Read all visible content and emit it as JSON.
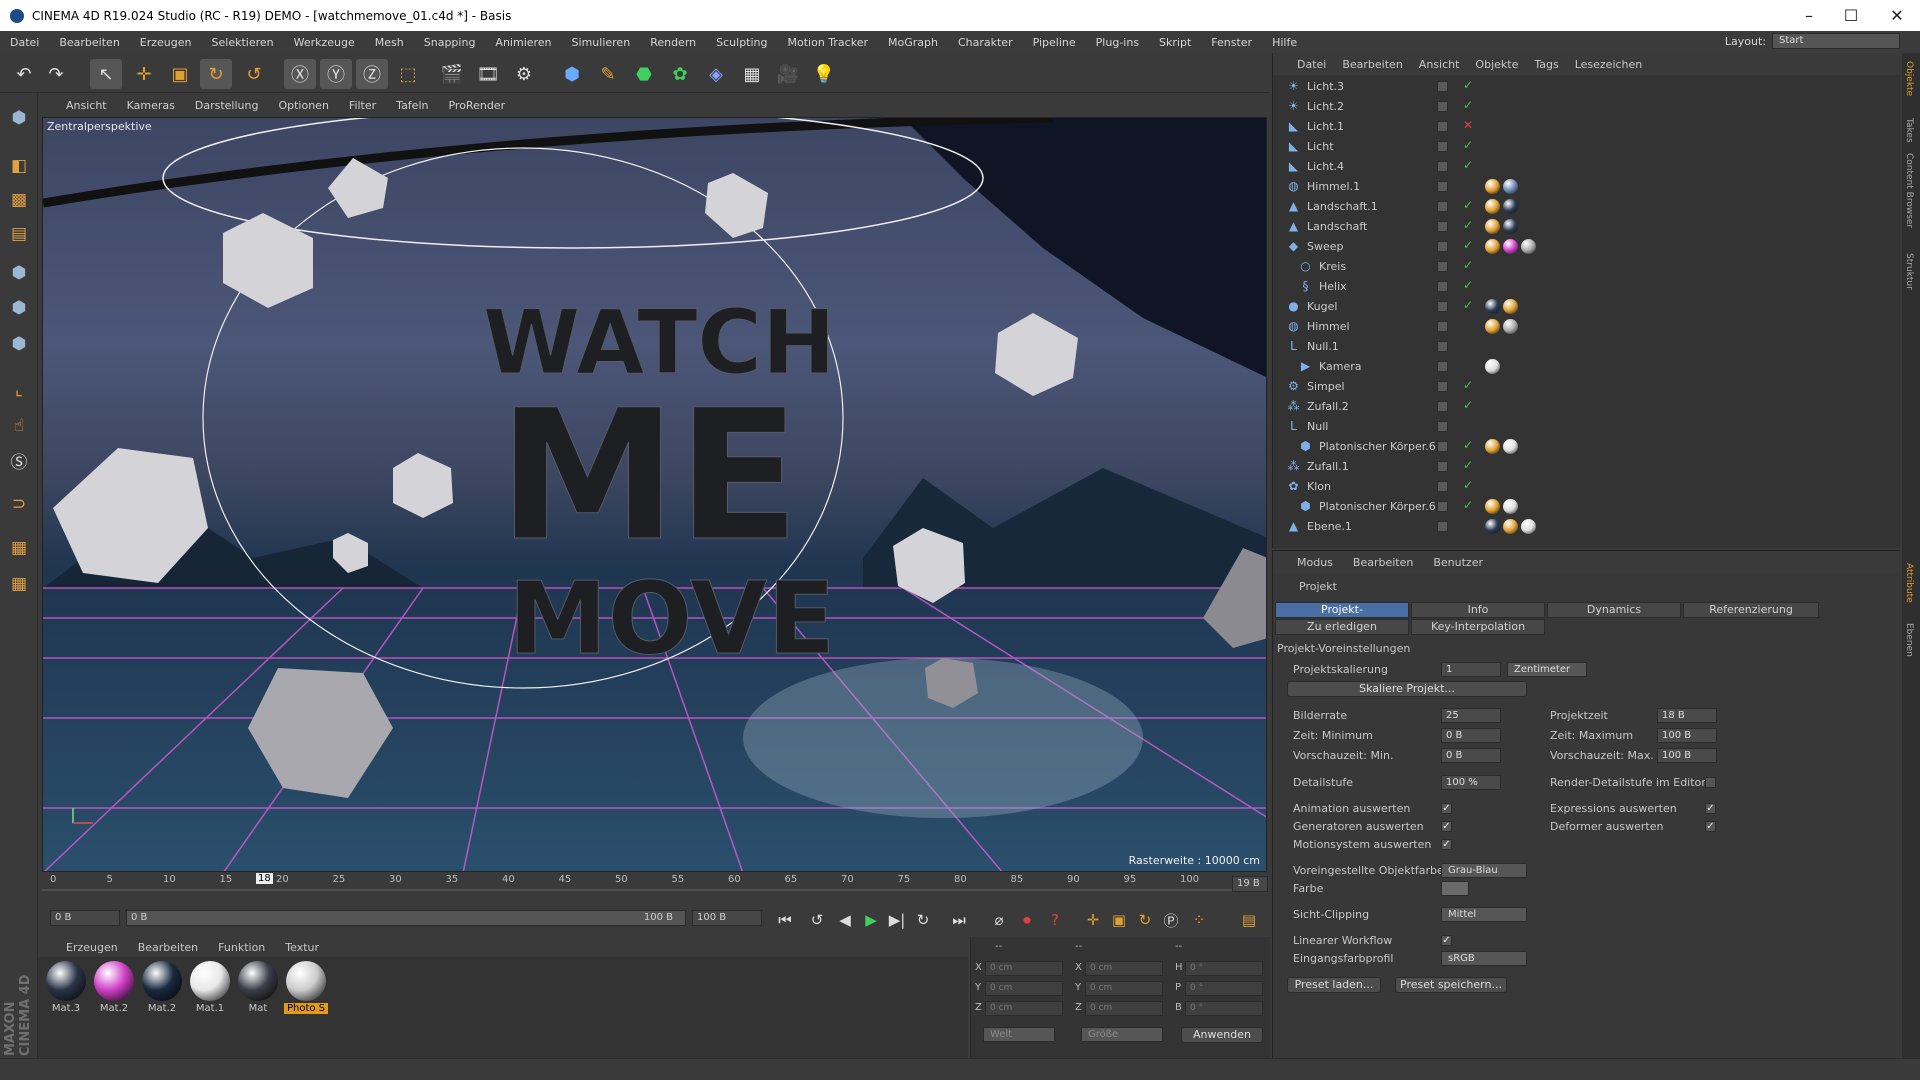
{
  "window": {
    "title": "CINEMA 4D R19.024 Studio (RC - R19) DEMO - [watchmemove_01.c4d *] - Basis",
    "minimize": "–",
    "maximize": "☐",
    "close": "✕"
  },
  "menubar": {
    "items": [
      "Datei",
      "Bearbeiten",
      "Erzeugen",
      "Selektieren",
      "Werkzeuge",
      "Mesh",
      "Snapping",
      "Animieren",
      "Simulieren",
      "Rendern",
      "Sculpting",
      "Motion Tracker",
      "MoGraph",
      "Charakter",
      "Pipeline",
      "Plug-ins",
      "Skript",
      "Fenster",
      "Hilfe"
    ],
    "layout_label": "Layout:",
    "layout_value": "Start"
  },
  "toolbar": {
    "tools": [
      "undo-icon",
      "select-icon",
      "move-icon",
      "scale-icon",
      "rotate-icon",
      "rotate-icon",
      "x-axis-icon",
      "y-axis-icon",
      "z-axis-icon",
      "coord-icon",
      "render-view-icon",
      "render-icon",
      "render-settings-icon",
      "cube-icon",
      "pen-icon",
      "subdivision-icon",
      "cloner-icon",
      "deformer-icon",
      "floor-icon",
      "camera-icon",
      "light-icon"
    ]
  },
  "viewport": {
    "menu": [
      "Ansicht",
      "Kameras",
      "Darstellung",
      "Optionen",
      "Filter",
      "Tafeln",
      "ProRender"
    ],
    "camera_label": "Zentralperspektive",
    "raster_label": "Rasterweite : 10000 cm",
    "text_lines": [
      "WATCH",
      "ME",
      "MOVE"
    ]
  },
  "timeline": {
    "ticks": [
      "0",
      "5",
      "10",
      "15",
      "20",
      "25",
      "30",
      "35",
      "40",
      "45",
      "50",
      "55",
      "60",
      "65",
      "70",
      "75",
      "80",
      "85",
      "90",
      "95",
      "100"
    ],
    "current_frame": "18",
    "end_label": "19 B",
    "start_field": "0 B",
    "range_start": "0 B",
    "range_end": "100 B",
    "end_field": "100 B"
  },
  "materials": {
    "menu": [
      "Erzeugen",
      "Bearbeiten",
      "Funktion",
      "Textur"
    ],
    "items": [
      {
        "name": "Mat.3",
        "color": "#2a3448"
      },
      {
        "name": "Mat.2",
        "color": "#d040c8"
      },
      {
        "name": "Mat.2",
        "color": "#1a2a40"
      },
      {
        "name": "Mat.1",
        "color": "#e8e8e8"
      },
      {
        "name": "Mat",
        "color": "#3a3e48"
      },
      {
        "name": "Photo S",
        "color": "#cccccc"
      }
    ]
  },
  "coords": {
    "header": [
      "--",
      "--",
      "--"
    ],
    "rows": [
      {
        "a": "X",
        "av": "0 cm",
        "b": "X",
        "bv": "0 cm",
        "c": "H",
        "cv": "0 °"
      },
      {
        "a": "Y",
        "av": "0 cm",
        "b": "Y",
        "bv": "0 cm",
        "c": "P",
        "cv": "0 °"
      },
      {
        "a": "Z",
        "av": "0 cm",
        "b": "Z",
        "bv": "0 cm",
        "c": "B",
        "cv": "0 °"
      }
    ],
    "mode1": "Welt",
    "mode2": "Größe",
    "apply": "Anwenden"
  },
  "objects": {
    "menu": [
      "Datei",
      "Bearbeiten",
      "Ansicht",
      "Objekte",
      "Tags",
      "Lesezeichen"
    ],
    "rows": [
      {
        "name": "Licht.3",
        "indent": 0,
        "icon": "light-icon",
        "mark": "✓",
        "markColor": "#46c846"
      },
      {
        "name": "Licht.2",
        "indent": 0,
        "icon": "light-icon",
        "mark": "✓",
        "markColor": "#46c846"
      },
      {
        "name": "Licht.1",
        "indent": 0,
        "icon": "spotlight-icon",
        "mark": "✕",
        "markColor": "#e04040"
      },
      {
        "name": "Licht",
        "indent": 0,
        "icon": "spotlight-icon",
        "mark": "✓",
        "markColor": "#46c846"
      },
      {
        "name": "Licht.4",
        "indent": 0,
        "icon": "spotlight-icon",
        "mark": "✓",
        "markColor": "#46c846"
      },
      {
        "name": "Himmel.1",
        "indent": 0,
        "icon": "sky-icon",
        "mark": "",
        "markColor": "#46c846"
      },
      {
        "name": "Landschaft.1",
        "indent": 0,
        "icon": "landscape-icon",
        "mark": "✓",
        "markColor": "#46c846"
      },
      {
        "name": "Landschaft",
        "indent": 0,
        "icon": "landscape-icon",
        "mark": "✓",
        "markColor": "#46c846"
      },
      {
        "name": "Sweep",
        "indent": 0,
        "icon": "sweep-icon",
        "mark": "✓",
        "markColor": "#46c846"
      },
      {
        "name": "Kreis",
        "indent": 1,
        "icon": "circle-icon",
        "mark": "✓",
        "markColor": "#46c846"
      },
      {
        "name": "Helix",
        "indent": 1,
        "icon": "helix-icon",
        "mark": "✓",
        "markColor": "#46c846"
      },
      {
        "name": "Kugel",
        "indent": 0,
        "icon": "sphere-icon",
        "mark": "✓",
        "markColor": "#46c846"
      },
      {
        "name": "Himmel",
        "indent": 0,
        "icon": "sky-icon",
        "mark": "",
        "markColor": "#46c846"
      },
      {
        "name": "Null.1",
        "indent": 0,
        "icon": "null-icon",
        "mark": "",
        "markColor": "#46c846"
      },
      {
        "name": "Kamera",
        "indent": 1,
        "icon": "camera-icon",
        "mark": "",
        "markColor": "#46c846"
      },
      {
        "name": "Simpel",
        "indent": 0,
        "icon": "effector-icon",
        "mark": "✓",
        "markColor": "#46c846"
      },
      {
        "name": "Zufall.2",
        "indent": 0,
        "icon": "random-icon",
        "mark": "✓",
        "markColor": "#46c846"
      },
      {
        "name": "Null",
        "indent": 0,
        "icon": "null-icon",
        "mark": "",
        "markColor": "#46c846"
      },
      {
        "name": "Platonischer Körper.6",
        "indent": 1,
        "icon": "platonic-icon",
        "mark": "✓",
        "markColor": "#46c846"
      },
      {
        "name": "Zufall.1",
        "indent": 0,
        "icon": "random-icon",
        "mark": "✓",
        "markColor": "#46c846"
      },
      {
        "name": "Klon",
        "indent": 0,
        "icon": "cloner-icon",
        "mark": "✓",
        "markColor": "#46c846"
      },
      {
        "name": "Platonischer Körper.6",
        "indent": 1,
        "icon": "platonic-icon",
        "mark": "✓",
        "markColor": "#46c846"
      },
      {
        "name": "Ebene.1",
        "indent": 0,
        "icon": "plane-icon",
        "mark": "",
        "markColor": "#46c846"
      }
    ]
  },
  "attributes": {
    "menu": [
      "Modus",
      "Bearbeiten",
      "Benutzer"
    ],
    "title": "Projekt",
    "tabs": [
      "Projekt-Voreinstellungen",
      "Info",
      "Dynamics",
      "Referenzierung",
      "Zu erledigen",
      "Key-Interpolation"
    ],
    "section": "Projekt-Voreinstellungen",
    "projektskalierung_label": "Projektskalierung",
    "projektskalierung": "1",
    "unit": "Zentimeter",
    "skaliere": "Skaliere Projekt...",
    "bilderrate_label": "Bilderrate",
    "bilderrate": "25",
    "projektzeit_label": "Projektzeit",
    "projektzeit": "18 B",
    "zeitmin_label": "Zeit: Minimum",
    "zeitmin": "0 B",
    "zeitmax_label": "Zeit: Maximum",
    "zeitmax": "100 B",
    "vormin_label": "Vorschauzeit: Min.",
    "vormin": "0 B",
    "vormax_label": "Vorschauzeit: Max.",
    "vormax": "100 B",
    "detail_label": "Detailstufe",
    "detail": "100 %",
    "renderdetail_label": "Render-Detailstufe im Editor",
    "anim_label": "Animation auswerten",
    "expr_label": "Expressions auswerten",
    "gen_label": "Generatoren auswerten",
    "deform_label": "Deformer auswerten",
    "motion_label": "Motionsystem auswerten",
    "objfarbe_label": "Voreingestellte Objektfarbe",
    "objfarbe": "Grau-Blau",
    "farbe_label": "Farbe",
    "clip_label": "Sicht-Clipping",
    "clip": "Mittel",
    "linear_label": "Linearer Workflow",
    "profil_label": "Eingangsfarbprofil",
    "profil": "sRGB",
    "preset_load": "Preset laden...",
    "preset_save": "Preset speichern..."
  },
  "sidetabs": [
    "Objekte",
    "Takes",
    "Content Browser",
    "Struktur",
    "Attribute",
    "Ebenen"
  ],
  "branding": "MAXON CINEMA 4D"
}
